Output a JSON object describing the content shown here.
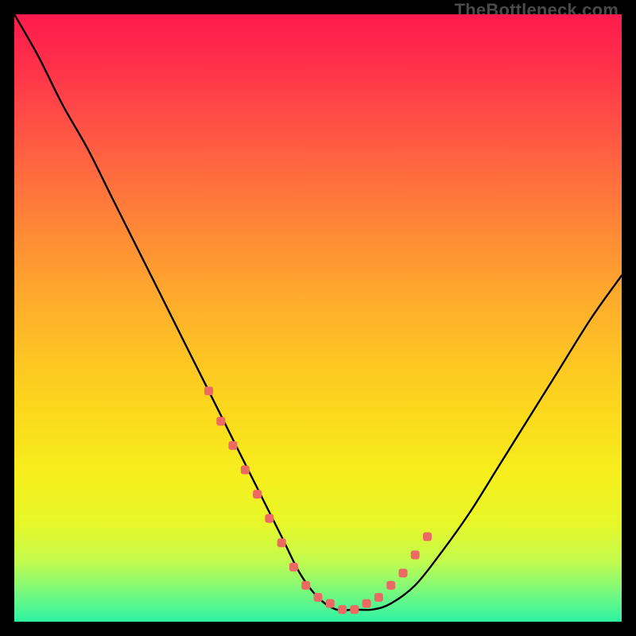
{
  "watermark": "TheBottleneck.com",
  "chart_data": {
    "type": "line",
    "title": "",
    "xlabel": "",
    "ylabel": "",
    "xlim": [
      0,
      100
    ],
    "ylim": [
      0,
      100
    ],
    "series": [
      {
        "name": "bottleneck-curve",
        "x": [
          0,
          4,
          8,
          12,
          16,
          20,
          24,
          28,
          32,
          36,
          40,
          44,
          47,
          50,
          53,
          56,
          59,
          62,
          66,
          70,
          75,
          80,
          85,
          90,
          95,
          100
        ],
        "values": [
          100,
          93,
          85,
          78,
          70,
          62,
          54,
          46,
          38,
          30,
          22,
          14,
          8,
          4,
          2,
          2,
          2,
          3,
          6,
          11,
          18,
          26,
          34,
          42,
          50,
          57
        ]
      }
    ],
    "markers": {
      "name": "highlight-band",
      "x": [
        32,
        34,
        36,
        38,
        40,
        42,
        44,
        46,
        48,
        50,
        52,
        54,
        56,
        58,
        60,
        62,
        64,
        66,
        68
      ],
      "values": [
        38,
        33,
        29,
        25,
        21,
        17,
        13,
        9,
        6,
        4,
        3,
        2,
        2,
        3,
        4,
        6,
        8,
        11,
        14
      ],
      "color": "#ec6a62"
    },
    "background": {
      "gradient_top": "#ff1a4d",
      "gradient_bottom": "#2ef3a5"
    }
  }
}
